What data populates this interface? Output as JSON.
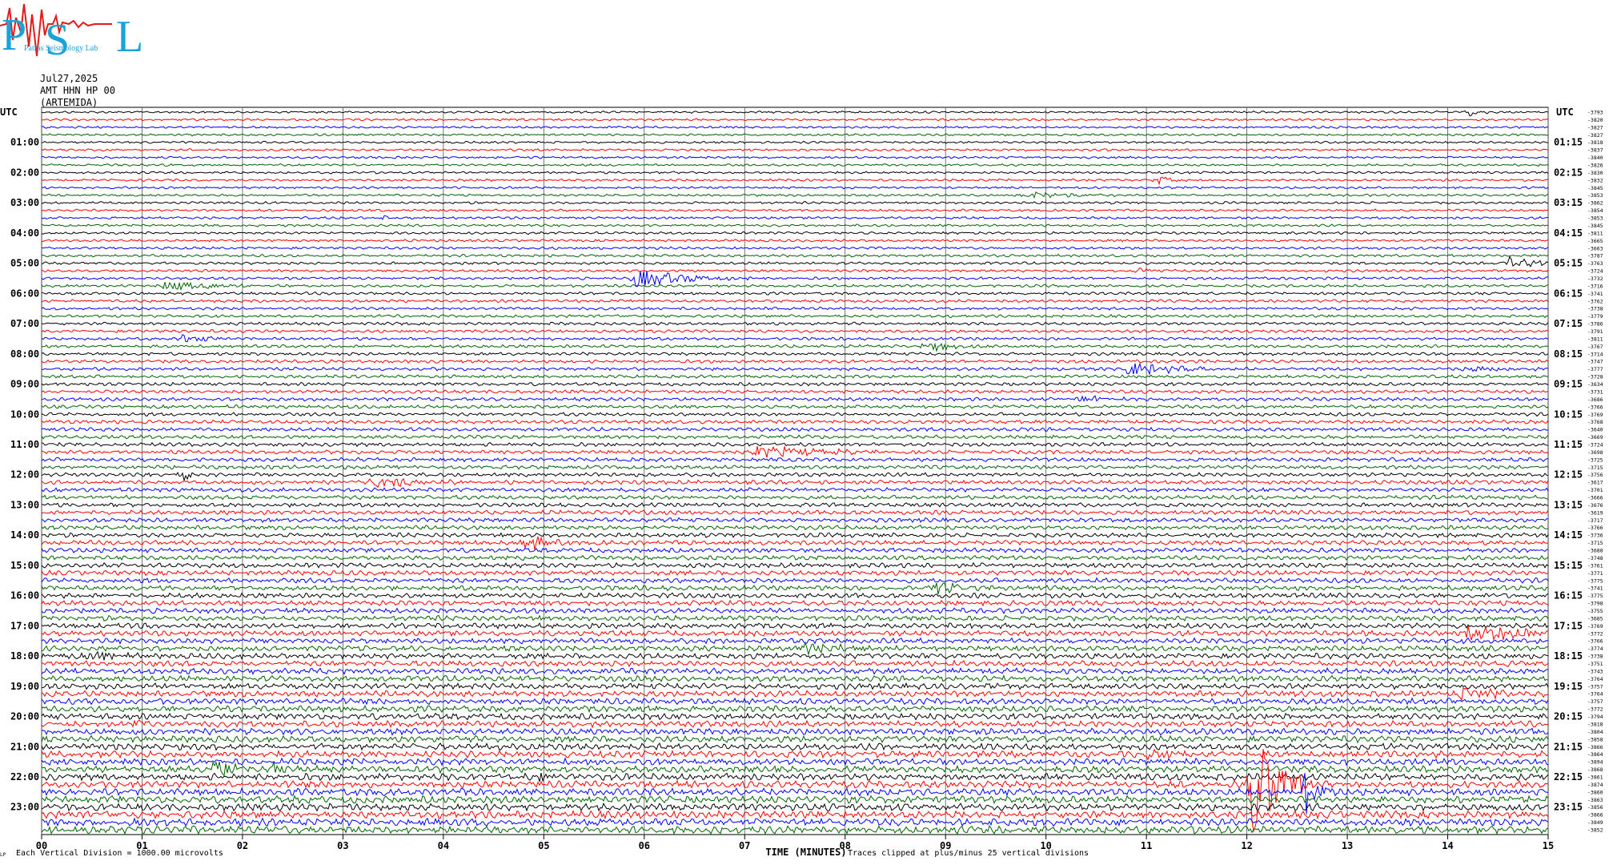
{
  "header": {
    "date": "Jul27,2025",
    "station": "AMT HHN HP 00",
    "location": "(ARTEMIDA)"
  },
  "logo": {
    "letters": [
      "P",
      "S",
      "L"
    ],
    "text": "Patras Seismology Lab"
  },
  "footer": {
    "division_note": "Each Vertical Division = 1000.00 microvolts",
    "clip_note": "Traces clipped at plus/minus 25 vertical divisions",
    "corner_mark": "LP"
  },
  "chart_data": {
    "type": "seismogram-helicorder",
    "xlabel": "TIME (MINUTES)",
    "xlim": [
      0,
      15
    ],
    "x_ticks": [
      "00",
      "01",
      "02",
      "03",
      "04",
      "05",
      "06",
      "07",
      "08",
      "09",
      "10",
      "11",
      "12",
      "13",
      "14",
      "15"
    ],
    "left_axis_label": "UTC",
    "right_axis_label": "UTC",
    "left_hour_labels": [
      "01:00",
      "02:00",
      "03:00",
      "04:00",
      "05:00",
      "06:00",
      "07:00",
      "08:00",
      "09:00",
      "10:00",
      "11:00",
      "12:00",
      "13:00",
      "14:00",
      "15:00",
      "16:00",
      "17:00",
      "18:00",
      "19:00",
      "20:00",
      "21:00",
      "22:00",
      "23:00"
    ],
    "right_hour_labels": [
      "01:15",
      "02:15",
      "03:15",
      "04:15",
      "05:15",
      "06:15",
      "07:15",
      "08:15",
      "09:15",
      "10:15",
      "11:15",
      "12:15",
      "13:15",
      "14:15",
      "15:15",
      "16:15",
      "17:15",
      "18:15",
      "19:15",
      "20:15",
      "21:15",
      "22:15",
      "23:15"
    ],
    "trace_count": 96,
    "trace_minutes": 15,
    "trace_colors": [
      "#000000",
      "#ff0000",
      "#0000ff",
      "#006400"
    ],
    "right_trace_means": [
      -3793,
      -3820,
      -3827,
      -3827,
      -3818,
      -3837,
      -3840,
      -3826,
      -3830,
      -3832,
      -3845,
      -3853,
      -3862,
      -3854,
      -3853,
      -3845,
      -3811,
      -3665,
      -3663,
      -3787,
      -3763,
      -3724,
      -3732,
      -3716,
      -3741,
      -3762,
      -3738,
      -3779,
      -3786,
      -3791,
      -3811,
      -3767,
      -3714,
      -3747,
      -3777,
      -3728,
      -3634,
      -3731,
      -3686,
      -3766,
      -3769,
      -3768,
      -3640,
      -3669,
      -3724,
      -3698,
      -3725,
      -3715,
      -3756,
      -3617,
      -3701,
      -3666,
      -3676,
      -3619,
      -3717,
      -3766,
      -3736,
      -3715,
      -3688,
      -3748,
      -3761,
      -3771,
      -3775,
      -3741,
      -3775,
      -3798,
      -3755,
      -3685,
      -3769,
      -3772,
      -3766,
      -3774,
      -3738,
      -3751,
      -3743,
      -3764,
      -3757,
      -3764,
      -3757,
      -3772,
      -3794,
      -3818,
      -3804,
      -3858,
      -3866,
      -3864,
      -3894,
      -3868,
      -3861,
      -3874,
      -3860,
      -3863,
      -3856,
      -3866,
      -3849,
      -3852
    ],
    "events": [
      {
        "trace": 0,
        "minute": 14.2,
        "amplitude": 2,
        "duration": 0.2
      },
      {
        "trace": 9,
        "minute": 11.1,
        "amplitude": 2,
        "duration": 0.3
      },
      {
        "trace": 11,
        "minute": 9.8,
        "amplitude": 1.5,
        "duration": 1.0
      },
      {
        "trace": 14,
        "minute": 3.4,
        "amplitude": 2,
        "duration": 0.1
      },
      {
        "trace": 20,
        "minute": 14.6,
        "amplitude": 2.5,
        "duration": 0.8
      },
      {
        "trace": 21,
        "minute": 10.9,
        "amplitude": 2,
        "duration": 0.2
      },
      {
        "trace": 22,
        "minute": 5.9,
        "amplitude": 4,
        "duration": 1.2
      },
      {
        "trace": 23,
        "minute": 1.2,
        "amplitude": 2,
        "duration": 1.2
      },
      {
        "trace": 30,
        "minute": 1.4,
        "amplitude": 1.5,
        "duration": 0.6
      },
      {
        "trace": 31,
        "minute": 8.8,
        "amplitude": 2,
        "duration": 0.8
      },
      {
        "trace": 34,
        "minute": 14.2,
        "amplitude": 1.5,
        "duration": 0.8
      },
      {
        "trace": 34,
        "minute": 10.8,
        "amplitude": 3,
        "duration": 1.0
      },
      {
        "trace": 38,
        "minute": 10.3,
        "amplitude": 2,
        "duration": 0.6
      },
      {
        "trace": 45,
        "minute": 7.1,
        "amplitude": 3,
        "duration": 1.2
      },
      {
        "trace": 48,
        "minute": 1.4,
        "amplitude": 4,
        "duration": 0.2
      },
      {
        "trace": 49,
        "minute": 3.3,
        "amplitude": 2.5,
        "duration": 1.0
      },
      {
        "trace": 57,
        "minute": 4.8,
        "amplitude": 4,
        "duration": 0.4
      },
      {
        "trace": 63,
        "minute": 8.9,
        "amplitude": 3,
        "duration": 0.6
      },
      {
        "trace": 69,
        "minute": 14.2,
        "amplitude": 4,
        "duration": 1.2
      },
      {
        "trace": 72,
        "minute": 0.5,
        "amplitude": 3,
        "duration": 0.6
      },
      {
        "trace": 71,
        "minute": 7.6,
        "amplitude": 3,
        "duration": 0.7
      },
      {
        "trace": 77,
        "minute": 14.1,
        "amplitude": 3,
        "duration": 1.0
      },
      {
        "trace": 81,
        "minute": 0.9,
        "amplitude": 3,
        "duration": 0.2
      },
      {
        "trace": 85,
        "minute": 11.0,
        "amplitude": 2.5,
        "duration": 0.8
      },
      {
        "trace": 87,
        "minute": 1.7,
        "amplitude": 6,
        "duration": 0.4
      },
      {
        "trace": 87,
        "minute": 2.3,
        "amplitude": 3,
        "duration": 0.2
      },
      {
        "trace": 88,
        "minute": 4.95,
        "amplitude": 3,
        "duration": 0.2
      },
      {
        "trace": 89,
        "minute": 12.05,
        "amplitude": 25,
        "duration": 0.6
      },
      {
        "trace": 90,
        "minute": 12.55,
        "amplitude": 12,
        "duration": 0.3
      }
    ],
    "grid": true
  }
}
